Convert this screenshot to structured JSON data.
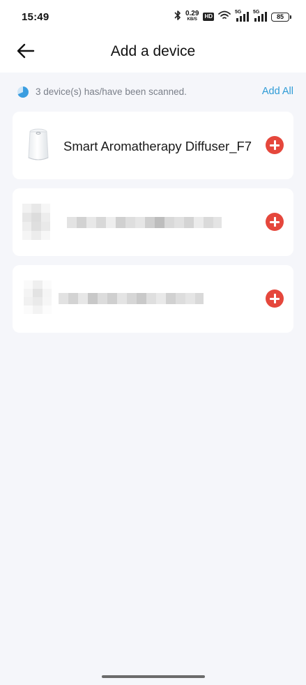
{
  "status_bar": {
    "time": "15:49",
    "net_speed_value": "0.29",
    "net_speed_unit": "KB/S",
    "hd_label": "HD",
    "sim1_tag": "5G",
    "sim2_tag": "5G",
    "battery_level": "85"
  },
  "header": {
    "title": "Add a device",
    "back_icon": "arrow-left-icon"
  },
  "scan": {
    "status_text": "3 device(s) has/have been scanned.",
    "add_all_label": "Add All",
    "accent_color": "#2e9bd6"
  },
  "devices": [
    {
      "name": "Smart Aromatherapy Diffuser_F7",
      "image": "aroma-diffuser-icon",
      "add_icon": "plus-circle-icon",
      "obscured": false
    },
    {
      "name": "",
      "image": "blurred-device-icon",
      "add_icon": "plus-circle-icon",
      "obscured": true
    },
    {
      "name": "",
      "image": "blurred-device-icon",
      "add_icon": "plus-circle-icon",
      "obscured": true
    }
  ],
  "colors": {
    "add_button": "#e5473c",
    "background": "#f5f6fa",
    "card": "#ffffff"
  }
}
